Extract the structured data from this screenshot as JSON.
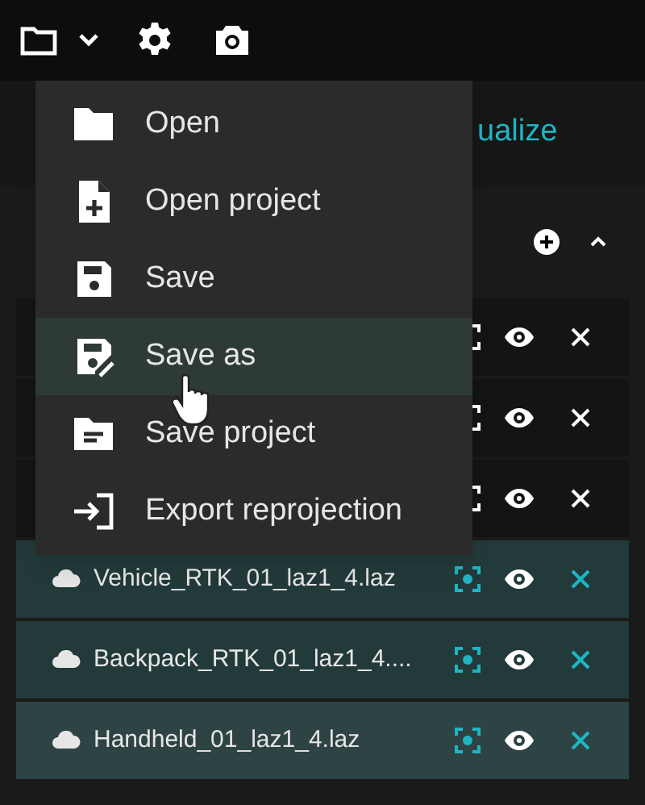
{
  "toolbar": {
    "buttons": [
      {
        "kind": "folder"
      },
      {
        "kind": "caret"
      },
      {
        "kind": "gear"
      },
      {
        "kind": "camera"
      }
    ]
  },
  "tab": {
    "label": "ualize"
  },
  "menu": {
    "items": [
      {
        "kind": "open",
        "label": "Open",
        "selected": false
      },
      {
        "kind": "open_project",
        "label": "Open project",
        "selected": false
      },
      {
        "kind": "save",
        "label": "Save",
        "selected": false
      },
      {
        "kind": "save_as",
        "label": "Save as",
        "selected": true
      },
      {
        "kind": "save_project",
        "label": "Save project",
        "selected": false
      },
      {
        "kind": "export",
        "label": "Export reprojection",
        "selected": false
      }
    ]
  },
  "layers": [
    {
      "selected": false,
      "hovered": false
    },
    {
      "selected": false,
      "hovered": false
    },
    {
      "selected": false,
      "hovered": false
    },
    {
      "name": "Vehicle_RTK_01_laz1_4.laz",
      "selected": true,
      "hovered": false
    },
    {
      "name": "Backpack_RTK_01_laz1_4....",
      "selected": true,
      "hovered": false
    },
    {
      "name": "Handheld_01_laz1_4.laz",
      "selected": true,
      "hovered": true
    }
  ]
}
